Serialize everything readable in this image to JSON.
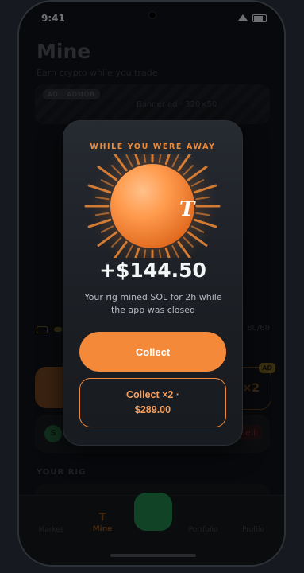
{
  "status": {
    "time": "9:41"
  },
  "page": {
    "title": "Mine",
    "subtitle": "Earn crypto while you trade",
    "banner_tag": "AD · ADMOB",
    "banner_text": "Banner ad · 320×50",
    "energy_value": "60/60",
    "x2_label": "×2",
    "x2_badge": "AD",
    "coin_letter": "S",
    "sell_label": "Sell",
    "section_rig": "YOUR RIG"
  },
  "tabs": [
    {
      "label": "Market",
      "active": false
    },
    {
      "label": "Mine",
      "active": true,
      "icon": "T"
    },
    {
      "label": "Portfolio",
      "active": false
    },
    {
      "label": "Profile",
      "active": false
    }
  ],
  "modal": {
    "eyebrow": "WHILE YOU WERE AWAY",
    "coin_glyph": "T",
    "amount": "+$144.50",
    "description": "Your rig mined SOL for 2h while the app was closed",
    "collect_label": "Collect",
    "collect_double_line1": "Collect ×2 ·",
    "collect_double_line2": "$289.00",
    "accent": "#f5893a"
  }
}
